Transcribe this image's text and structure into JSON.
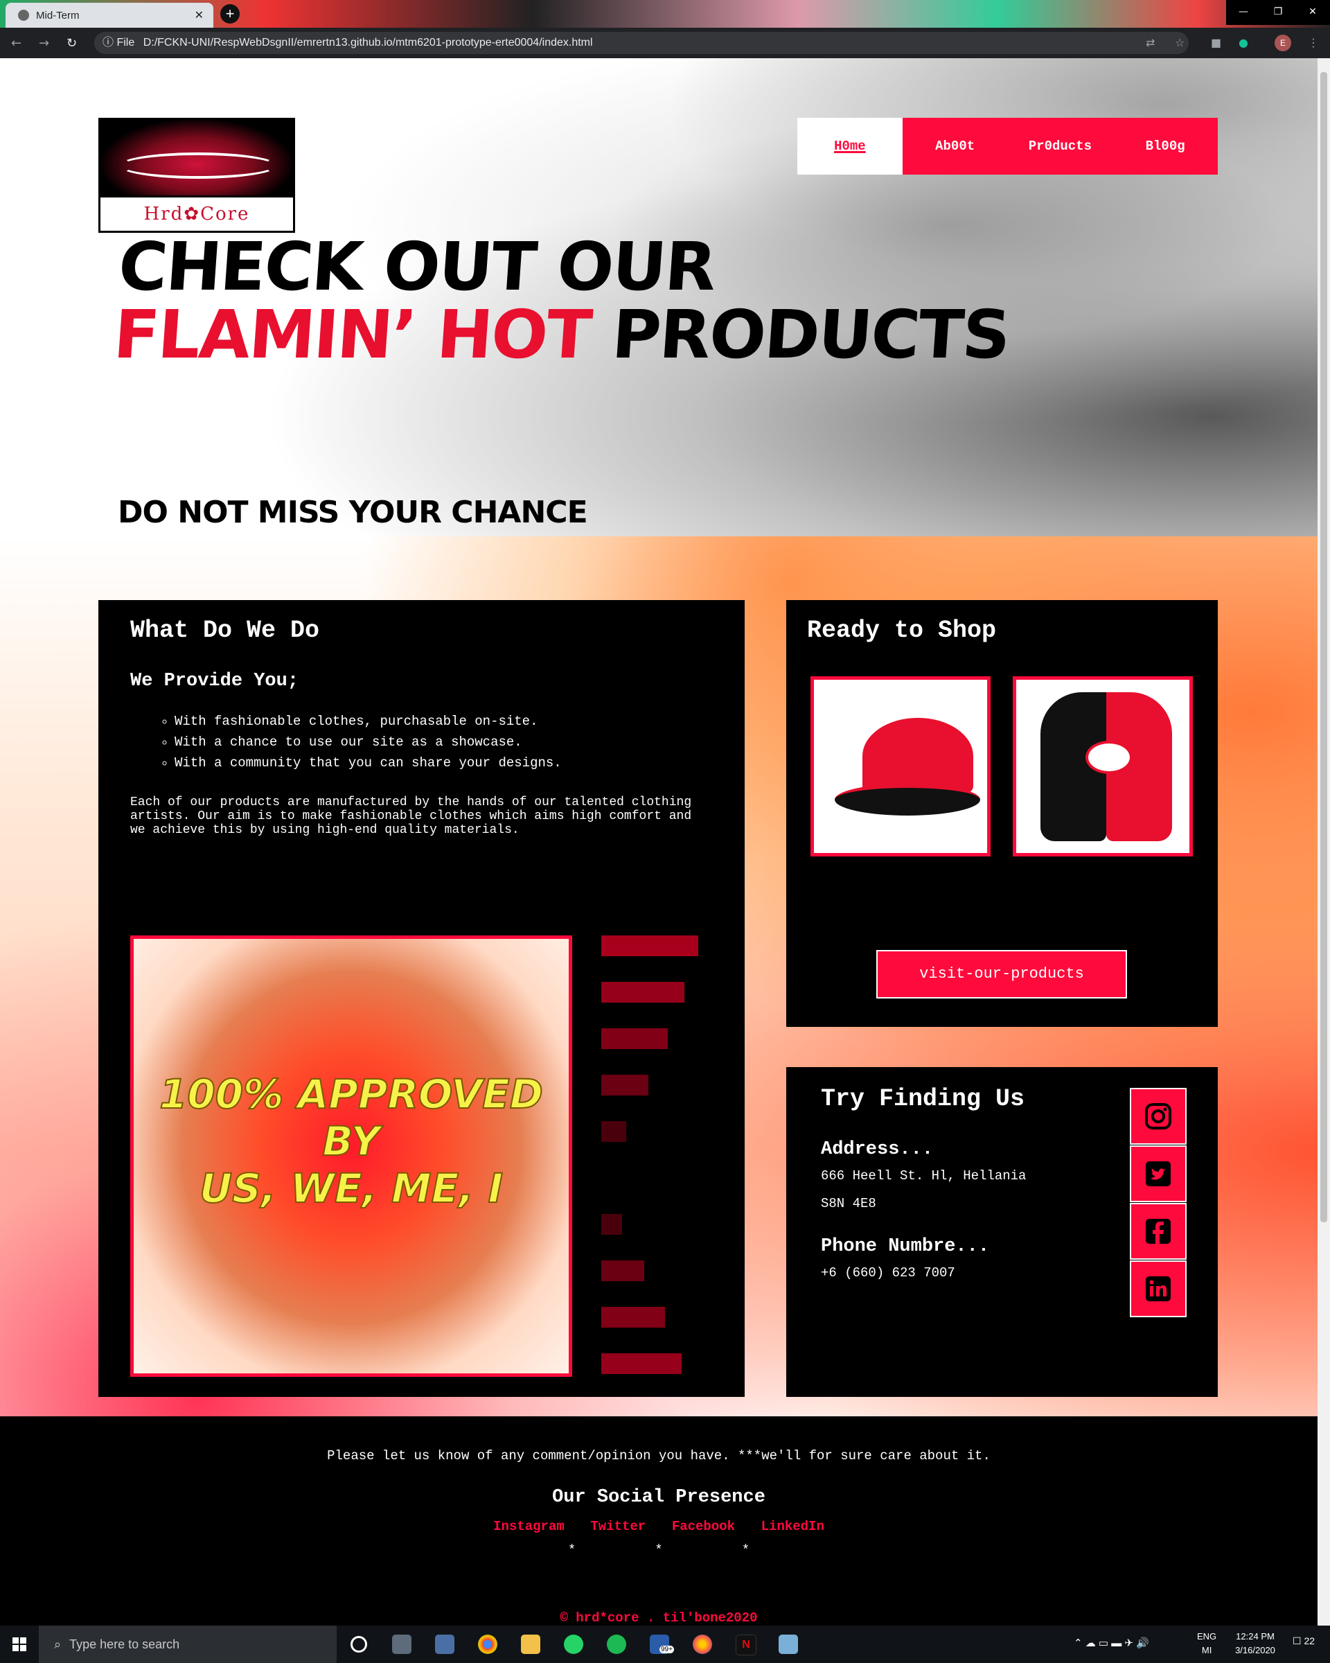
{
  "browser": {
    "tab_title": "Mid-Term",
    "tab_close": "✕",
    "new_tab": "+",
    "info_label": "ⓘ File",
    "url": "D:/FCKN-UNI/RespWebDsgnII/emrertn13.github.io/mtm6201-prototype-erte0004/index.html",
    "profile_initial": "E"
  },
  "site": {
    "logo_text": "Hrd✿Core",
    "nav": [
      "H0me",
      "Ab00t",
      "Pr0ducts",
      "Bl00g"
    ],
    "hero": {
      "line1": "CHECK OUT OUR",
      "line2_hot": "FLAMIN’ HOT",
      "line2_rest": "PRODUCTS",
      "sub": "DO NOT MISS YOUR CHANCE"
    },
    "what": {
      "title": "What Do We Do",
      "subtitle": "We Provide You;",
      "items": [
        "With fashionable clothes, purchasable on-site.",
        "With a chance to use our site as a showcase.",
        "With a community that you can share your designs."
      ],
      "paragraph": "Each of our products are manufactured by the hands of our talented clothing artists. Our aim is to make fashionable clothes which aims high comfort and we achieve this by using high-end quality materials.",
      "approved_lines": [
        "100% APPROVED",
        "BY",
        "US, WE, ME, I"
      ]
    },
    "shop": {
      "title": "Ready to Shop",
      "button": "visit-our-products"
    },
    "find": {
      "title": "Try Finding Us",
      "address_label": "Address...",
      "address_line1": "666 Heell St. Hl, Hellania",
      "address_line2": "S8N 4E8",
      "phone_label": "Phone Numbre...",
      "phone": "+6 (660) 623 7007"
    },
    "footer": {
      "message": "Please let us know of any comment/opinion you have. ***we'll for sure care about it.",
      "social_heading": "Our Social Presence",
      "links": [
        "Instagram",
        "Twitter",
        "Facebook",
        "LinkedIn"
      ],
      "stars": "*          *          *",
      "copyright": "© hrd*core . til'bone2020"
    }
  },
  "taskbar": {
    "search_placeholder": "Type here to search",
    "lang_top": "ENG",
    "lang_bottom": "MI",
    "time": "12:24 PM",
    "date": "3/16/2020",
    "mail_badge": "99+",
    "notif_count": "22"
  },
  "colors": {
    "accent": "#ff0a3c",
    "panel": "#000000",
    "bar": "#8b0014"
  }
}
